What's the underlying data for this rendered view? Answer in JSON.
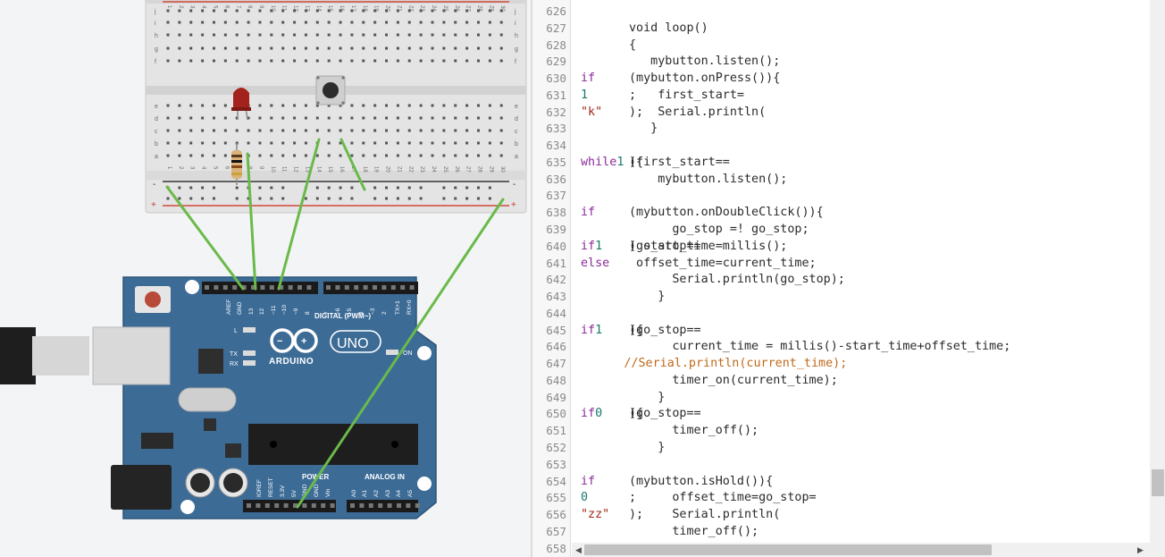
{
  "circuit": {
    "board_logo": "ARDUINO",
    "board_model": "UNO",
    "digital_header_label": "DIGITAL (PWM~)",
    "power_label": "POWER",
    "analog_label": "ANALOG IN",
    "pin_labels_top": [
      "AREF",
      "GND",
      "13",
      "12",
      "~11",
      "~10",
      "~9",
      "8",
      "7",
      "~6",
      "~5",
      "4",
      "~3",
      "2",
      "TX+1",
      "RX+0"
    ],
    "pin_labels_bottom": [
      "IOREF",
      "RESET",
      "3.3V",
      "5V",
      "GND",
      "GND",
      "Vin",
      "A0",
      "A1",
      "A2",
      "A3",
      "A4",
      "A5"
    ],
    "led_labels": [
      "L",
      "TX",
      "RX",
      "ON"
    ],
    "breadboard_rows_top": [
      "j",
      "i",
      "h",
      "g",
      "f"
    ],
    "breadboard_rows_bottom": [
      "e",
      "d",
      "c",
      "b",
      "a"
    ],
    "breadboard_columns": [
      "1",
      "2",
      "3",
      "4",
      "5",
      "6",
      "7",
      "8",
      "9",
      "10",
      "11",
      "12",
      "13",
      "14",
      "15",
      "16",
      "17",
      "18",
      "19",
      "20",
      "21",
      "22",
      "23",
      "24",
      "25",
      "26",
      "27",
      "28",
      "29",
      "30"
    ],
    "rail_minus": "-",
    "rail_plus": "+",
    "wire_color": "#6aba4a"
  },
  "code_editor": {
    "lines": [
      {
        "n": "626",
        "segs": []
      },
      {
        "n": "627",
        "segs": [
          {
            "t": "void loop()",
            "c": "txt"
          }
        ]
      },
      {
        "n": "628",
        "segs": [
          {
            "t": "{",
            "c": "txt"
          }
        ]
      },
      {
        "n": "629",
        "segs": [
          {
            "t": "   mybutton.listen();",
            "c": "txt"
          }
        ]
      },
      {
        "n": "630",
        "segs": [
          {
            "t": "  ",
            "c": "txt"
          },
          {
            "t": "if",
            "c": "kw"
          },
          {
            "t": "(mybutton.onPress()){",
            "c": "txt"
          }
        ]
      },
      {
        "n": "631",
        "segs": [
          {
            "t": "    first_start=",
            "c": "txt"
          },
          {
            "t": "1",
            "c": "num"
          },
          {
            "t": ";",
            "c": "txt"
          }
        ]
      },
      {
        "n": "632",
        "segs": [
          {
            "t": "    Serial.println(",
            "c": "txt"
          },
          {
            "t": "\"k\"",
            "c": "str"
          },
          {
            "t": ");",
            "c": "txt"
          }
        ]
      },
      {
        "n": "633",
        "segs": [
          {
            "t": "   }",
            "c": "txt"
          }
        ]
      },
      {
        "n": "634",
        "segs": []
      },
      {
        "n": "635",
        "segs": [
          {
            "t": "  ",
            "c": "txt"
          },
          {
            "t": "while",
            "c": "kw"
          },
          {
            "t": "(first_start==",
            "c": "txt"
          },
          {
            "t": "1",
            "c": "num"
          },
          {
            "t": "){",
            "c": "txt"
          }
        ]
      },
      {
        "n": "636",
        "segs": [
          {
            "t": "    mybutton.listen();",
            "c": "txt"
          }
        ]
      },
      {
        "n": "637",
        "segs": []
      },
      {
        "n": "638",
        "segs": [
          {
            "t": "    ",
            "c": "txt"
          },
          {
            "t": "if",
            "c": "kw"
          },
          {
            "t": "(mybutton.onDoubleClick()){",
            "c": "txt"
          }
        ]
      },
      {
        "n": "639",
        "segs": [
          {
            "t": "      go_stop =! go_stop;",
            "c": "txt"
          }
        ]
      },
      {
        "n": "640",
        "segs": [
          {
            "t": "      ",
            "c": "txt"
          },
          {
            "t": "if",
            "c": "kw"
          },
          {
            "t": "(go_stop==",
            "c": "txt"
          },
          {
            "t": "1",
            "c": "num"
          },
          {
            "t": ") start_time=millis();",
            "c": "txt"
          }
        ]
      },
      {
        "n": "641",
        "segs": [
          {
            "t": "      ",
            "c": "txt"
          },
          {
            "t": "else",
            "c": "kw"
          },
          {
            "t": " offset_time=current_time;",
            "c": "txt"
          }
        ]
      },
      {
        "n": "642",
        "segs": [
          {
            "t": "      Serial.println(go_stop);",
            "c": "txt"
          }
        ]
      },
      {
        "n": "643",
        "segs": [
          {
            "t": "    }",
            "c": "txt"
          }
        ]
      },
      {
        "n": "644",
        "segs": []
      },
      {
        "n": "645",
        "segs": [
          {
            "t": "    ",
            "c": "txt"
          },
          {
            "t": "if",
            "c": "kw"
          },
          {
            "t": "(go_stop==",
            "c": "txt"
          },
          {
            "t": "1",
            "c": "num"
          },
          {
            "t": "){",
            "c": "txt"
          }
        ]
      },
      {
        "n": "646",
        "segs": [
          {
            "t": "      current_time = millis()-start_time+offset_time;",
            "c": "txt"
          }
        ]
      },
      {
        "n": "647",
        "segs": [
          {
            "t": "      //Serial.println(current_time);",
            "c": "cmt"
          }
        ]
      },
      {
        "n": "648",
        "segs": [
          {
            "t": "      timer_on(current_time);",
            "c": "txt"
          }
        ]
      },
      {
        "n": "649",
        "segs": [
          {
            "t": "    }",
            "c": "txt"
          }
        ]
      },
      {
        "n": "650",
        "segs": [
          {
            "t": "    ",
            "c": "txt"
          },
          {
            "t": "if",
            "c": "kw"
          },
          {
            "t": "(go_stop==",
            "c": "txt"
          },
          {
            "t": "0",
            "c": "num"
          },
          {
            "t": "){",
            "c": "txt"
          }
        ]
      },
      {
        "n": "651",
        "segs": [
          {
            "t": "      timer_off();",
            "c": "txt"
          }
        ]
      },
      {
        "n": "652",
        "segs": [
          {
            "t": "    }",
            "c": "txt"
          }
        ]
      },
      {
        "n": "653",
        "segs": []
      },
      {
        "n": "654",
        "segs": [
          {
            "t": "    ",
            "c": "txt"
          },
          {
            "t": "if",
            "c": "kw"
          },
          {
            "t": "(mybutton.isHold()){",
            "c": "txt"
          }
        ]
      },
      {
        "n": "655",
        "segs": [
          {
            "t": "      offset_time=go_stop=",
            "c": "txt"
          },
          {
            "t": "0",
            "c": "num"
          },
          {
            "t": ";",
            "c": "txt"
          }
        ]
      },
      {
        "n": "656",
        "segs": [
          {
            "t": "      Serial.println(",
            "c": "txt"
          },
          {
            "t": "\"zz\"",
            "c": "str"
          },
          {
            "t": ");",
            "c": "txt"
          }
        ]
      },
      {
        "n": "657",
        "segs": [
          {
            "t": "      timer_off();",
            "c": "txt"
          }
        ]
      },
      {
        "n": "658",
        "segs": []
      }
    ]
  }
}
